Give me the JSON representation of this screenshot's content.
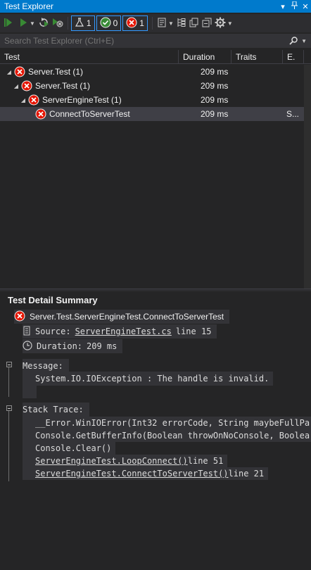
{
  "window": {
    "title": "Test Explorer",
    "controls": [
      "▾",
      "📌",
      "✕"
    ]
  },
  "toolbar": {
    "counts": {
      "total": "1",
      "passed": "0",
      "failed": "1"
    }
  },
  "search": {
    "placeholder": "Search Test Explorer (Ctrl+E)"
  },
  "columns": [
    "Test",
    "Duration",
    "Traits",
    "E."
  ],
  "tree": [
    {
      "name": "Server.Test (1)",
      "duration": "209 ms",
      "trait": ""
    },
    {
      "name": "Server.Test (1)",
      "duration": "209 ms",
      "trait": ""
    },
    {
      "name": "ServerEngineTest (1)",
      "duration": "209 ms",
      "trait": ""
    },
    {
      "name": "ConnectToServerTest",
      "duration": "209 ms",
      "trait": "S..."
    }
  ],
  "detail": {
    "title": "Test Detail Summary",
    "test_name": "Server.Test.ServerEngineTest.ConnectToServerTest",
    "source_label": "Source:",
    "source_file": "ServerEngineTest.cs",
    "source_line": "line 15",
    "duration_label": "Duration:",
    "duration_value": "209 ms",
    "message_label": "Message:",
    "message_text": "System.IO.IOException : The handle is invalid.",
    "stack_label": "Stack Trace:",
    "stack": [
      {
        "text": "__Error.WinIOError(Int32 errorCode, String maybeFullPa",
        "link": false,
        "suffix": ""
      },
      {
        "text": "Console.GetBufferInfo(Boolean throwOnNoConsole, Boolea",
        "link": false,
        "suffix": ""
      },
      {
        "text": "Console.Clear()",
        "link": false,
        "suffix": ""
      },
      {
        "text": "ServerEngineTest.LoopConnect()",
        "link": true,
        "suffix": " line 51"
      },
      {
        "text": "ServerEngineTest.ConnectToServerTest()",
        "link": true,
        "suffix": " line 21"
      }
    ]
  },
  "colors": {
    "accent": "#007acc",
    "fail": "#e51400",
    "pass": "#388a34",
    "link": "#3794ff",
    "error_link": "#f48771"
  }
}
